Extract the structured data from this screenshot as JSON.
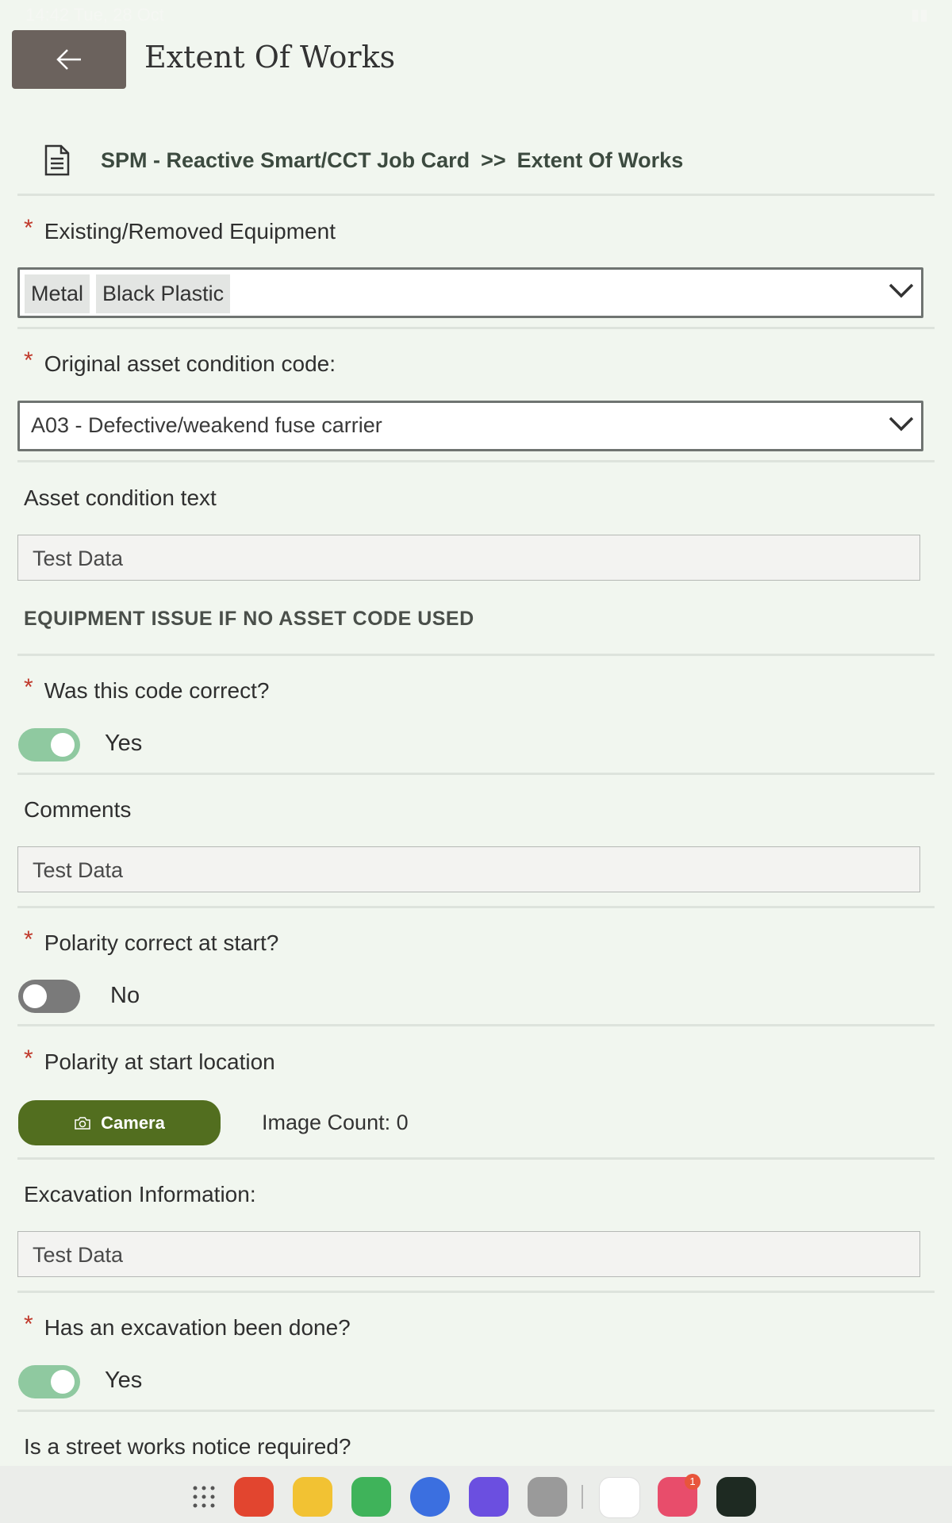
{
  "status_bar": {
    "time": "14:42",
    "date": "Tue, 28 Oct"
  },
  "header": {
    "title": "Extent Of Works"
  },
  "breadcrumb": {
    "parent": "SPM - Reactive Smart/CCT Job Card",
    "separator": ">>",
    "current": "Extent Of Works"
  },
  "form": {
    "existing_equipment": {
      "label": "Existing/Removed Equipment",
      "required": true,
      "chips": [
        "Metal",
        "Black Plastic"
      ]
    },
    "original_condition": {
      "label": "Original asset condition code:",
      "required": true,
      "value": "A03 - Defective/weakend fuse carrier"
    },
    "asset_condition_text": {
      "label": "Asset condition text",
      "value": "Test Data"
    },
    "equipment_issue_header": "EQUIPMENT ISSUE IF NO ASSET CODE USED",
    "code_correct": {
      "label": "Was this code correct?",
      "required": true,
      "value": "Yes",
      "on": true
    },
    "comments": {
      "label": "Comments",
      "value": "Test Data"
    },
    "polarity_start": {
      "label": "Polarity correct at start?",
      "required": true,
      "value": "No",
      "on": false
    },
    "polarity_location": {
      "label": "Polarity at start location",
      "required": true,
      "camera_label": "Camera",
      "image_count": "Image Count: 0"
    },
    "excavation_info": {
      "label": "Excavation Information:",
      "value": "Test Data"
    },
    "excavation_done": {
      "label": "Has an excavation been done?",
      "required": true,
      "value": "Yes",
      "on": true
    },
    "street_works": {
      "label": "Is a street works notice required?"
    }
  },
  "dock": {
    "apps": [
      "app-drawer",
      "notes-app",
      "files-app",
      "phone-app",
      "messages-app",
      "browser-app",
      "camera-app",
      "google-app",
      "store-app",
      "phone-link-app"
    ],
    "store_badge": "1"
  },
  "colors": {
    "background": "#f1f6ef",
    "accent": "#526e1f",
    "toggle_on": "#8fc9a0",
    "required": "#c0392b"
  }
}
